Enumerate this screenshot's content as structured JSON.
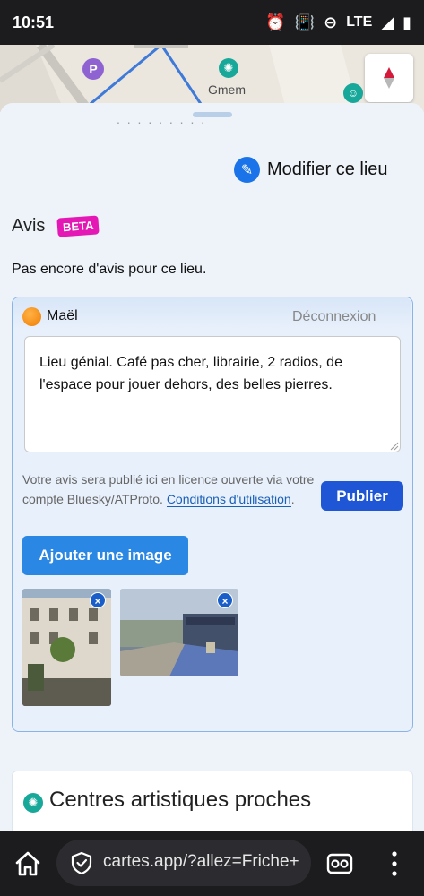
{
  "status_bar": {
    "time": "10:51",
    "network": "LTE",
    "icons": [
      "alarm-icon",
      "vibrate-icon",
      "do-not-disturb-icon",
      "signal-icon",
      "battery-icon"
    ]
  },
  "map": {
    "label": "Gmem",
    "parking_glyph": "P"
  },
  "sheet": {
    "edit_link": "Modifier ce lieu",
    "reviews_title": "Avis",
    "beta_badge": "BETA",
    "no_reviews": "Pas encore d'avis pour ce lieu."
  },
  "review_form": {
    "user_name": "Maël",
    "logout": "Déconnexion",
    "text_value": "Lieu génial. Café pas cher, librairie, 2 radios, de l'espace pour jouer dehors, des belles pierres.",
    "license_text": "Votre avis sera publié ici en licence ouverte via votre compte Bluesky/ATProto. ",
    "terms_link": "Conditions d'utilisation",
    "license_end": ".",
    "publish_button": "Publier",
    "add_image_button": "Ajouter une image",
    "images": [
      {
        "remove": "×"
      },
      {
        "remove": "×"
      }
    ]
  },
  "nearby": {
    "title": "Centres artistiques proches"
  },
  "browser": {
    "url": "cartes.app/?allez=Friche+"
  },
  "colors": {
    "accent": "#1e56d6",
    "beta": "#e418b5",
    "teal_poi": "#17a89a",
    "parking_poi": "#8f62d1"
  }
}
